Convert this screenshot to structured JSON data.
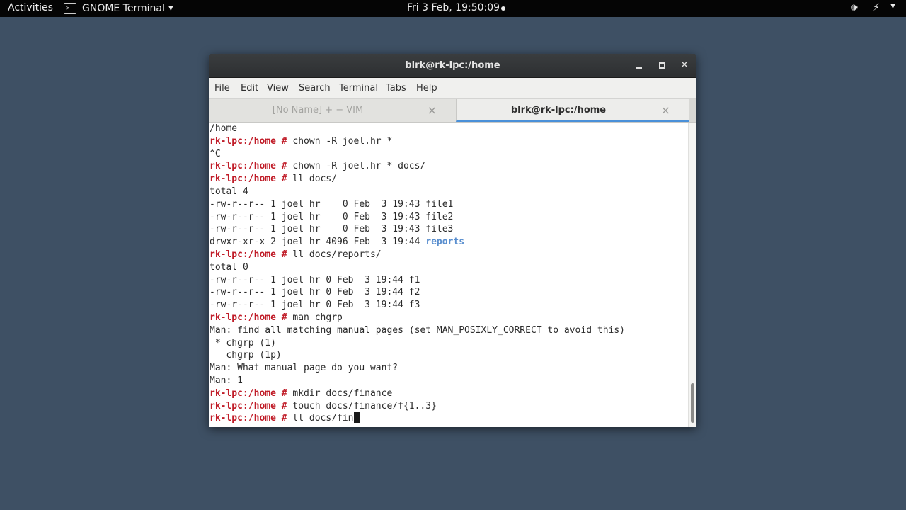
{
  "topbar": {
    "activities": "Activities",
    "app_name": "GNOME Terminal",
    "app_icon_glyph": ">_",
    "caret": "▼",
    "clock": "Fri  3 Feb, 19:50:09",
    "volume_icon": "🕪",
    "battery_icon": "⚡",
    "menu_caret": "▼"
  },
  "window": {
    "title": "blrk@rk-lpc:/home",
    "close_glyph": "✕",
    "menu": [
      "File",
      "Edit",
      "View",
      "Search",
      "Terminal",
      "Tabs",
      "Help"
    ],
    "tabs": [
      {
        "label": "[No Name] + − VIM",
        "close": "×"
      },
      {
        "label": "blrk@rk-lpc:/home",
        "close": "×"
      }
    ]
  },
  "terminal": {
    "prompt": "rk-lpc:/home #",
    "lines": [
      {
        "text": "/home"
      },
      {
        "prompt": true,
        "text": " chown -R joel.hr *"
      },
      {
        "text": "^C"
      },
      {
        "prompt": true,
        "text": " chown -R joel.hr * docs/"
      },
      {
        "prompt": true,
        "text": " ll docs/"
      },
      {
        "text": "total 4"
      },
      {
        "text": "-rw-r--r-- 1 joel hr    0 Feb  3 19:43 file1"
      },
      {
        "text": "-rw-r--r-- 1 joel hr    0 Feb  3 19:43 file2"
      },
      {
        "text": "-rw-r--r-- 1 joel hr    0 Feb  3 19:43 file3"
      },
      {
        "text": "drwxr-xr-x 2 joel hr 4096 Feb  3 19:44 ",
        "dir": "reports"
      },
      {
        "prompt": true,
        "text": " ll docs/reports/"
      },
      {
        "text": "total 0"
      },
      {
        "text": "-rw-r--r-- 1 joel hr 0 Feb  3 19:44 f1"
      },
      {
        "text": "-rw-r--r-- 1 joel hr 0 Feb  3 19:44 f2"
      },
      {
        "text": "-rw-r--r-- 1 joel hr 0 Feb  3 19:44 f3"
      },
      {
        "prompt": true,
        "text": " man chgrp"
      },
      {
        "text": "Man: find all matching manual pages (set MAN_POSIXLY_CORRECT to avoid this)"
      },
      {
        "text": " * chgrp (1)"
      },
      {
        "text": "   chgrp (1p)"
      },
      {
        "text": "Man: What manual page do you want?"
      },
      {
        "text": "Man: 1"
      },
      {
        "prompt": true,
        "text": " mkdir docs/finance"
      },
      {
        "prompt": true,
        "text": " touch docs/finance/f{1..3}"
      },
      {
        "prompt": true,
        "text": " ll docs/fin",
        "cursor": true
      }
    ]
  }
}
